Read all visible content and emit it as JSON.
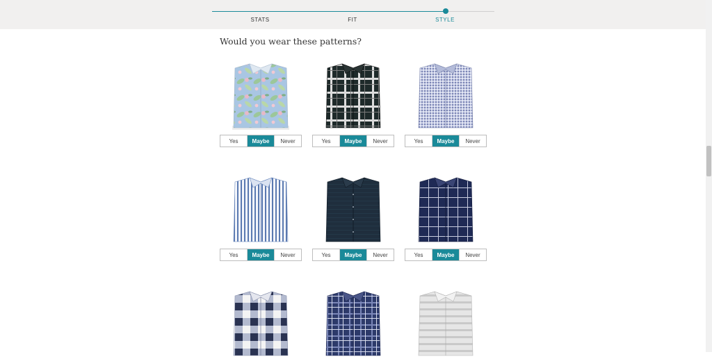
{
  "progress": {
    "steps": [
      {
        "label": "STATS",
        "active": false
      },
      {
        "label": "FIT",
        "active": false
      },
      {
        "label": "STYLE",
        "active": true
      }
    ]
  },
  "question": "Would you wear these patterns?",
  "options": [
    "Yes",
    "Maybe",
    "Never"
  ],
  "colors": {
    "accent": "#1a8a99",
    "header_bg": "#f1f0ef"
  },
  "shirts": [
    {
      "pattern": "tropical-floral-print",
      "selected": "Maybe"
    },
    {
      "pattern": "black-white-plaid",
      "selected": "Maybe"
    },
    {
      "pattern": "blue-mini-check",
      "selected": "Maybe"
    },
    {
      "pattern": "blue-white-stripe",
      "selected": "Maybe"
    },
    {
      "pattern": "dark-navy-solid",
      "selected": "Maybe"
    },
    {
      "pattern": "navy-windowpane",
      "selected": "Maybe"
    },
    {
      "pattern": "navy-white-buffalo-check",
      "selected": "Maybe"
    },
    {
      "pattern": "navy-tartan-plaid",
      "selected": "Maybe"
    },
    {
      "pattern": "grey-horizontal-stripe",
      "selected": "Maybe"
    }
  ]
}
